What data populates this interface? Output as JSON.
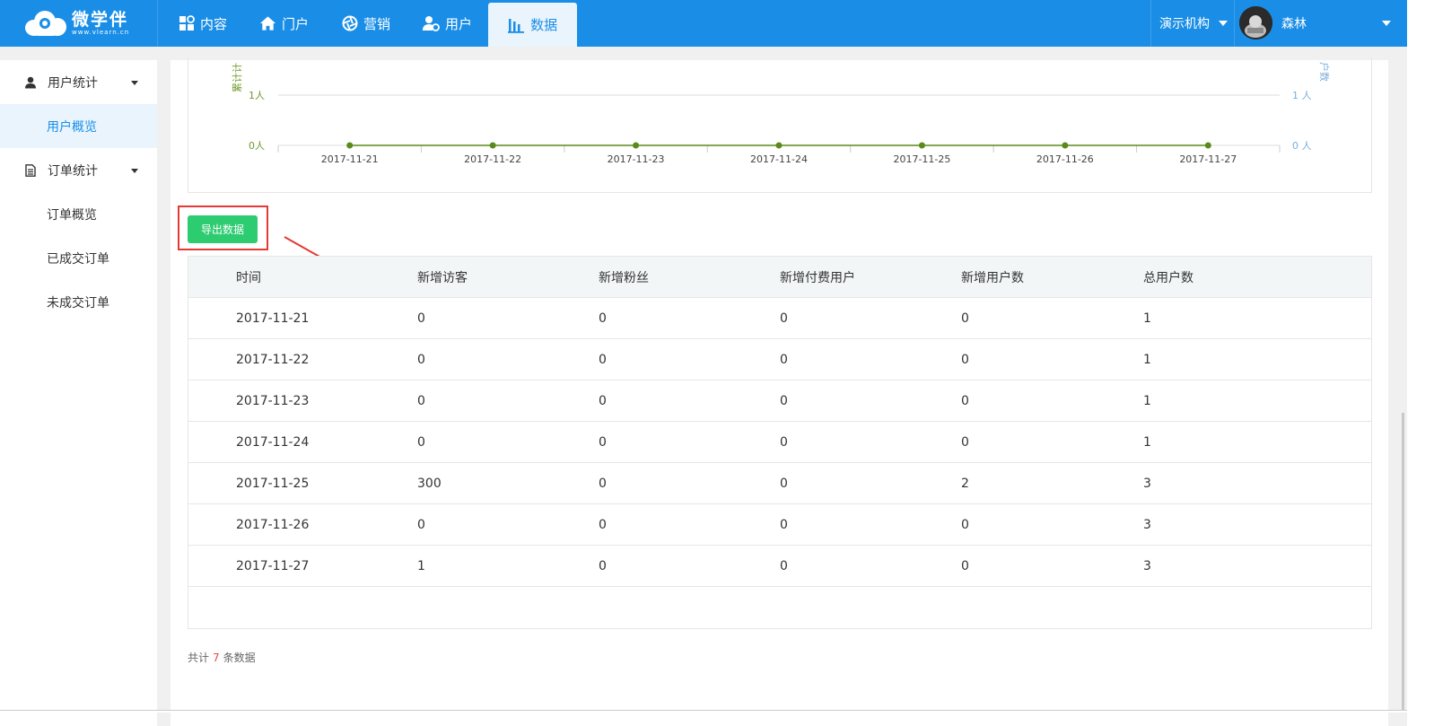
{
  "brand": {
    "name": "微学伴",
    "url": "www.vlearn.cn"
  },
  "nav": [
    {
      "label": "内容",
      "icon": "grid-icon"
    },
    {
      "label": "门户",
      "icon": "home-icon"
    },
    {
      "label": "营销",
      "icon": "aperture-icon"
    },
    {
      "label": "用户",
      "icon": "user-gear-icon"
    },
    {
      "label": "数据",
      "icon": "bar-chart-icon",
      "active": true
    }
  ],
  "header": {
    "org": "演示机构",
    "user": "森林"
  },
  "sidebar": {
    "groups": [
      {
        "label": "用户统计",
        "icon": "user-icon",
        "items": [
          {
            "label": "用户概览",
            "active": true
          }
        ]
      },
      {
        "label": "订单统计",
        "icon": "document-icon",
        "items": [
          {
            "label": "订单概览"
          },
          {
            "label": "已成交订单"
          },
          {
            "label": "未成交订单"
          }
        ]
      }
    ]
  },
  "chart_data": {
    "type": "line",
    "x": [
      "2017-11-21",
      "2017-11-22",
      "2017-11-23",
      "2017-11-24",
      "2017-11-25",
      "2017-11-26",
      "2017-11-27"
    ],
    "series": [
      {
        "values": [
          0,
          0,
          0,
          0,
          0,
          0,
          0
        ]
      }
    ],
    "left_axis": {
      "label": "累计计",
      "ticks": [
        "0人",
        "1人"
      ]
    },
    "right_axis": {
      "label": "户数",
      "ticks": [
        "0 人",
        "1 人"
      ]
    },
    "ylim": [
      0,
      1
    ],
    "colors": {
      "line": "#5a8a1a",
      "left_axis_text": "#6f9a2a",
      "right_axis_text": "#7aaedb"
    }
  },
  "actions": {
    "export": "导出数据"
  },
  "table": {
    "headers": [
      "时间",
      "新增访客",
      "新增粉丝",
      "新增付费用户",
      "新增用户数",
      "总用户数"
    ],
    "rows": [
      [
        "2017-11-21",
        "0",
        "0",
        "0",
        "0",
        "1"
      ],
      [
        "2017-11-22",
        "0",
        "0",
        "0",
        "0",
        "1"
      ],
      [
        "2017-11-23",
        "0",
        "0",
        "0",
        "0",
        "1"
      ],
      [
        "2017-11-24",
        "0",
        "0",
        "0",
        "0",
        "1"
      ],
      [
        "2017-11-25",
        "300",
        "0",
        "0",
        "2",
        "3"
      ],
      [
        "2017-11-26",
        "0",
        "0",
        "0",
        "0",
        "3"
      ],
      [
        "2017-11-27",
        "1",
        "0",
        "0",
        "0",
        "3"
      ]
    ]
  },
  "footer": {
    "prefix": "共计",
    "count": "7",
    "suffix": "条数据"
  },
  "colors": {
    "primary": "#1a8ee7",
    "export_button": "#2ecc71",
    "highlight": "#e53935"
  }
}
